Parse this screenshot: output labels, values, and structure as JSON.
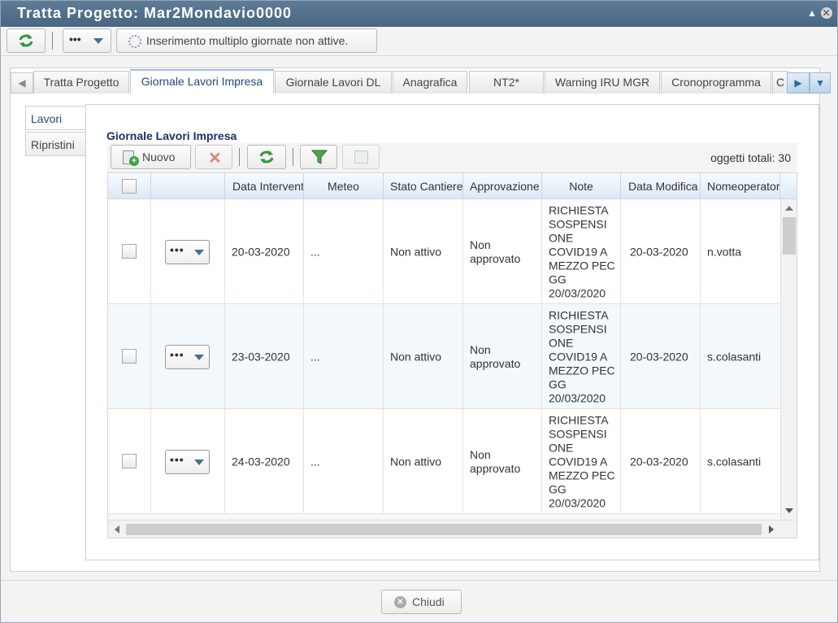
{
  "window": {
    "title": "Tratta Progetto: Mar2Mondavio0000",
    "collapse_icon": "triangle-up-icon",
    "close_icon": "close-icon"
  },
  "toolbar": {
    "refresh_icon": "refresh-icon",
    "more_dots": "•••",
    "multi_insert_label": "Inserimento multiplo giornate non attive."
  },
  "tabs": [
    {
      "label": "Tratta Progetto"
    },
    {
      "label": "Giornale Lavori Impresa",
      "active": true
    },
    {
      "label": "Giornale Lavori DL"
    },
    {
      "label": "Anagrafica"
    },
    {
      "label": "NT2*"
    },
    {
      "label": "Warning IRU MGR"
    },
    {
      "label": "Cronoprogramma"
    },
    {
      "label": "C"
    }
  ],
  "side_tabs": [
    {
      "label": "Lavori",
      "active": true
    },
    {
      "label": "Ripristini"
    }
  ],
  "grid": {
    "title": "Giornale Lavori Impresa",
    "new_label": "Nuovo",
    "total_label": "oggetti totali: 30",
    "columns": [
      "",
      "",
      "Data Intervento",
      "Meteo",
      "Stato Cantiere",
      "Approvazione",
      "Note",
      "Data Modifica",
      "Nomeoperatore"
    ],
    "rows": [
      {
        "data": "20-03-2020",
        "meteo": "...",
        "stato": "Non attivo",
        "approvazione": "Non approvato",
        "note": "RICHIESTA SOSPENSI ONE COVID19 A MEZZO PEC GG 20/03/2020",
        "modifica": "20-03-2020",
        "operatore": "n.votta",
        "more": "•••"
      },
      {
        "data": "23-03-2020",
        "meteo": "...",
        "stato": "Non attivo",
        "approvazione": "Non approvato",
        "note": "RICHIESTA SOSPENSI ONE COVID19 A MEZZO PEC GG 20/03/2020",
        "modifica": "20-03-2020",
        "operatore": "s.colasanti",
        "more": "•••"
      },
      {
        "data": "24-03-2020",
        "meteo": "...",
        "stato": "Non attivo",
        "approvazione": "Non approvato",
        "note": "RICHIESTA SOSPENSI ONE COVID19 A MEZZO PEC GG 20/03/2020",
        "modifica": "20-03-2020",
        "operatore": "s.colasanti",
        "more": "•••"
      }
    ]
  },
  "footer": {
    "close_label": "Chiudi"
  },
  "colors": {
    "title_bar": "#48667f",
    "accent": "#1a2f6b",
    "refresh_green": "#2e9a3a",
    "delete_red": "#d9534f"
  }
}
